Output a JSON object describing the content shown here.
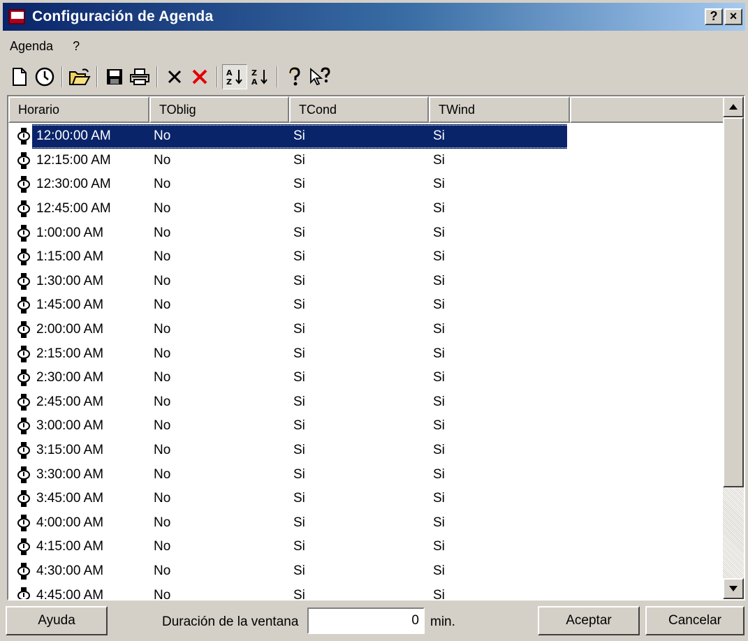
{
  "window": {
    "title": "Configuración de Agenda",
    "help_button": "?",
    "close_button": "×"
  },
  "menu": {
    "items": [
      "Agenda",
      "?"
    ]
  },
  "toolbar": {
    "icons": [
      "new-icon",
      "clock-icon",
      "open-icon",
      "save-icon",
      "print-icon",
      "delete-icon",
      "delete-all-icon",
      "sort-ascending-icon",
      "sort-descending-icon",
      "help-icon",
      "whats-this-icon"
    ],
    "sort_ascending_pressed": true
  },
  "table": {
    "columns": [
      "Horario",
      "TOblig",
      "TCond",
      "TWind"
    ],
    "selected_row": 0,
    "rows": [
      {
        "horario": "12:00:00 AM",
        "toblig": "No",
        "tcond": "Si",
        "twind": "Si"
      },
      {
        "horario": "12:15:00 AM",
        "toblig": "No",
        "tcond": "Si",
        "twind": "Si"
      },
      {
        "horario": "12:30:00 AM",
        "toblig": "No",
        "tcond": "Si",
        "twind": "Si"
      },
      {
        "horario": "12:45:00 AM",
        "toblig": "No",
        "tcond": "Si",
        "twind": "Si"
      },
      {
        "horario": "1:00:00 AM",
        "toblig": "No",
        "tcond": "Si",
        "twind": "Si"
      },
      {
        "horario": "1:15:00 AM",
        "toblig": "No",
        "tcond": "Si",
        "twind": "Si"
      },
      {
        "horario": "1:30:00 AM",
        "toblig": "No",
        "tcond": "Si",
        "twind": "Si"
      },
      {
        "horario": "1:45:00 AM",
        "toblig": "No",
        "tcond": "Si",
        "twind": "Si"
      },
      {
        "horario": "2:00:00 AM",
        "toblig": "No",
        "tcond": "Si",
        "twind": "Si"
      },
      {
        "horario": "2:15:00 AM",
        "toblig": "No",
        "tcond": "Si",
        "twind": "Si"
      },
      {
        "horario": "2:30:00 AM",
        "toblig": "No",
        "tcond": "Si",
        "twind": "Si"
      },
      {
        "horario": "2:45:00 AM",
        "toblig": "No",
        "tcond": "Si",
        "twind": "Si"
      },
      {
        "horario": "3:00:00 AM",
        "toblig": "No",
        "tcond": "Si",
        "twind": "Si"
      },
      {
        "horario": "3:15:00 AM",
        "toblig": "No",
        "tcond": "Si",
        "twind": "Si"
      },
      {
        "horario": "3:30:00 AM",
        "toblig": "No",
        "tcond": "Si",
        "twind": "Si"
      },
      {
        "horario": "3:45:00 AM",
        "toblig": "No",
        "tcond": "Si",
        "twind": "Si"
      },
      {
        "horario": "4:00:00 AM",
        "toblig": "No",
        "tcond": "Si",
        "twind": "Si"
      },
      {
        "horario": "4:15:00 AM",
        "toblig": "No",
        "tcond": "Si",
        "twind": "Si"
      },
      {
        "horario": "4:30:00 AM",
        "toblig": "No",
        "tcond": "Si",
        "twind": "Si"
      },
      {
        "horario": "4:45:00 AM",
        "toblig": "No",
        "tcond": "Si",
        "twind": "Si"
      }
    ]
  },
  "footer": {
    "help_label": "Ayuda",
    "duration_label": "Duración de la ventana",
    "duration_value": "0",
    "unit_label": "min.",
    "accept_label": "Aceptar",
    "cancel_label": "Cancelar"
  },
  "colors": {
    "titlebar_start": "#0a246a",
    "titlebar_end": "#a6caf0",
    "selection": "#0a246a",
    "face": "#d4d0c8"
  }
}
